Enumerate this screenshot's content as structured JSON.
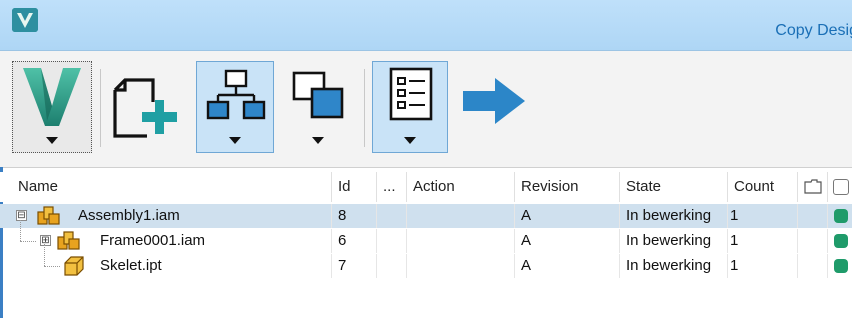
{
  "window": {
    "title": "Copy Desig",
    "title_color": "#1a6fb6",
    "titlebar_color": "#b9ddf8"
  },
  "toolbar": {
    "buttons": [
      {
        "icon": "vault-logo-icon",
        "dropdown": true,
        "selected": false
      },
      {
        "icon": "new-file-add-icon",
        "dropdown": false,
        "selected": false
      },
      {
        "icon": "hierarchy-view-icon",
        "dropdown": true,
        "selected": true
      },
      {
        "icon": "copy-layers-icon",
        "dropdown": true,
        "selected": false
      },
      {
        "icon": "checklist-icon",
        "dropdown": true,
        "selected": true
      },
      {
        "icon": "next-arrow-icon",
        "dropdown": false,
        "selected": false
      }
    ]
  },
  "grid": {
    "columns": {
      "name": "Name",
      "id": "Id",
      "more": "...",
      "action": "Action",
      "revision": "Revision",
      "state": "State",
      "count": "Count"
    },
    "rows": [
      {
        "name": "Assembly1.iam",
        "id": "8",
        "action": "",
        "revision": "A",
        "state": "In bewerking",
        "count": "1",
        "icon": "assembly-icon",
        "expander": "⊟",
        "selected": true
      },
      {
        "name": "Frame0001.iam",
        "id": "6",
        "action": "",
        "revision": "A",
        "state": "In bewerking",
        "count": "1",
        "icon": "assembly-icon",
        "expander": "⊞",
        "selected": false
      },
      {
        "name": "Skelet.ipt",
        "id": "7",
        "action": "",
        "revision": "A",
        "state": "In bewerking",
        "count": "1",
        "icon": "part-icon",
        "expander": "",
        "selected": false
      }
    ],
    "status_color": "#1f9b6a",
    "selected_row_color": "#cfe0ee"
  }
}
